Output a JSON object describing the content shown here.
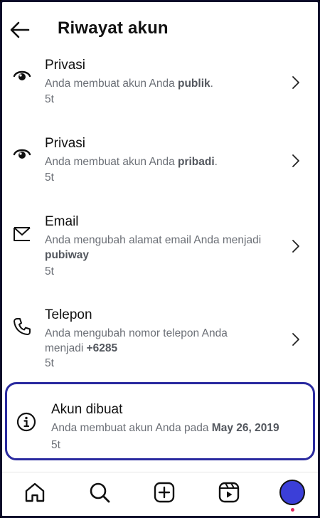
{
  "header": {
    "title": "Riwayat akun"
  },
  "items": [
    {
      "icon": "eye-icon",
      "title": "Privasi",
      "desc_pre": "Anda membuat akun Anda ",
      "desc_bold": "publik",
      "desc_post": ".",
      "time": "5t"
    },
    {
      "icon": "eye-icon",
      "title": "Privasi",
      "desc_pre": "Anda membuat akun Anda ",
      "desc_bold": "pribadi",
      "desc_post": ".",
      "time": "5t"
    },
    {
      "icon": "mail-icon",
      "title": "Email",
      "desc_pre": "Anda mengubah alamat email Anda menjadi ",
      "desc_bold": "pubiway",
      "desc_post": "",
      "time": "5t"
    },
    {
      "icon": "phone-icon",
      "title": "Telepon",
      "desc_pre": "Anda mengubah nomor telepon Anda menjadi ",
      "desc_bold": "+6285",
      "desc_post": "",
      "time": "5t"
    }
  ],
  "highlight": {
    "icon": "info-icon",
    "title": "Akun dibuat",
    "desc_pre": "Anda membuat akun Anda pada ",
    "desc_bold": "May 26, 2019",
    "time": "5t"
  },
  "nav": {
    "items": [
      "home-icon",
      "search-icon",
      "create-icon",
      "reels-icon",
      "profile-avatar"
    ],
    "avatar_color": "#3b3fd8",
    "notification_dot_color": "#e0245e"
  }
}
